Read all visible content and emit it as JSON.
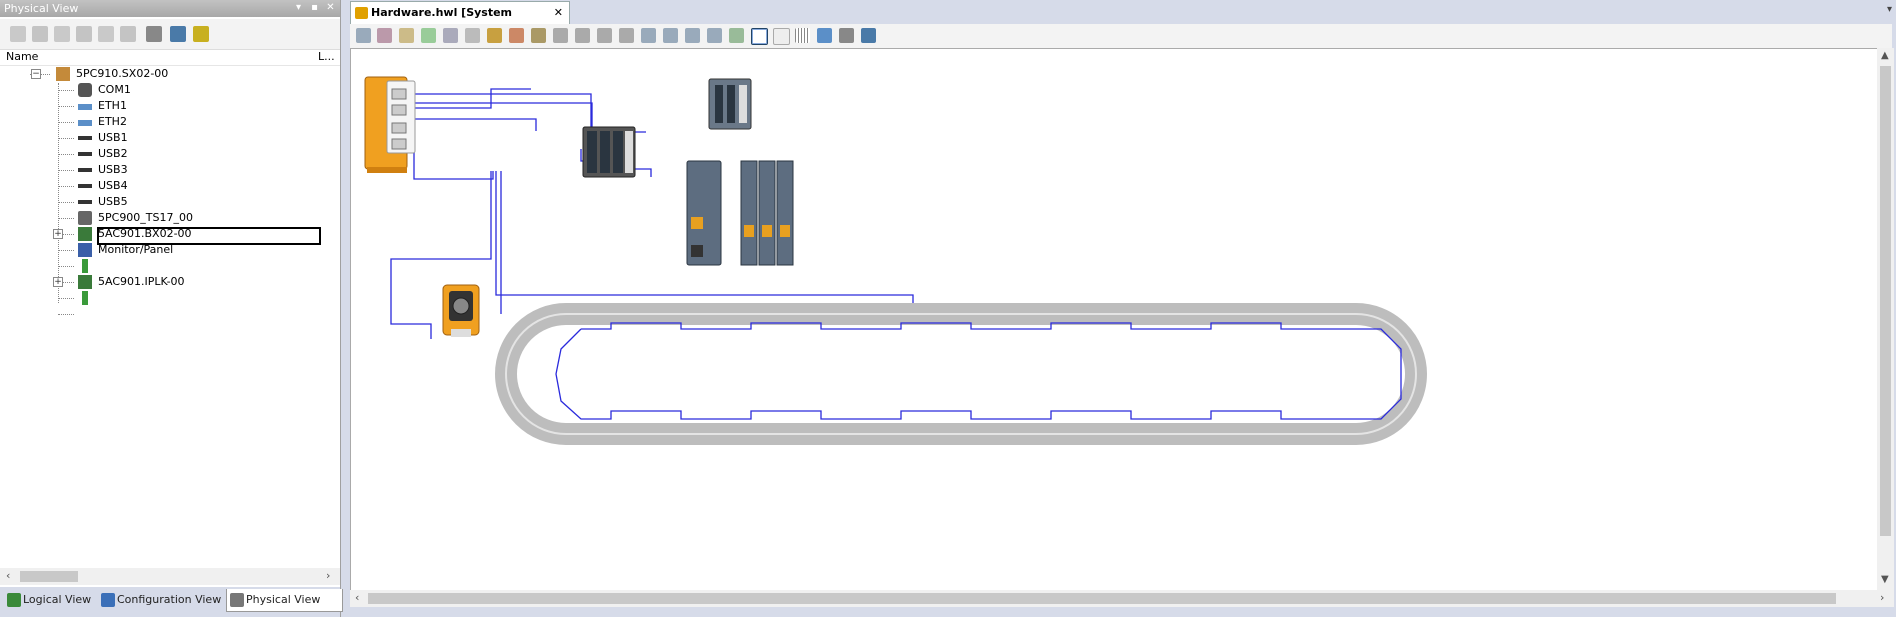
{
  "left_panel": {
    "title": "Physical View",
    "title_buttons": [
      "▾",
      "▪",
      "✕"
    ],
    "columns": {
      "name": "Name",
      "l": "L..."
    },
    "tree": [
      {
        "label": "5PC910.SX02-00",
        "icon": "pc-icon",
        "level": 0,
        "expanded": true
      },
      {
        "label": "COM1",
        "icon": "serial-port-icon",
        "level": 1
      },
      {
        "label": "ETH1",
        "icon": "ethernet-icon",
        "level": 1
      },
      {
        "label": "ETH2",
        "icon": "ethernet-icon",
        "level": 1
      },
      {
        "label": "USB1",
        "icon": "usb-icon",
        "level": 1
      },
      {
        "label": "USB2",
        "icon": "usb-icon",
        "level": 1
      },
      {
        "label": "USB3",
        "icon": "usb-icon",
        "level": 1
      },
      {
        "label": "USB4",
        "icon": "usb-icon",
        "level": 1
      },
      {
        "label": "USB5",
        "icon": "usb-icon",
        "level": 1
      },
      {
        "label": "5PC900_TS17_00",
        "icon": "module-icon",
        "level": 1
      },
      {
        "label": "5AC901.BX02-00",
        "icon": "card-icon",
        "level": 1,
        "selected": true,
        "collapsed": true
      },
      {
        "label": "Monitor/Panel",
        "icon": "monitor-icon",
        "level": 1
      },
      {
        "label": "",
        "icon": "plug-icon",
        "level": 1
      },
      {
        "label": "5AC901.IPLK-00",
        "icon": "card-icon",
        "level": 1,
        "collapsed": true
      },
      {
        "label": "",
        "icon": "plug-icon",
        "level": 1
      }
    ],
    "bottom_tabs": [
      {
        "label": "Logical View",
        "icon": "logical-view-icon",
        "active": false
      },
      {
        "label": "Configuration View",
        "icon": "configuration-view-icon",
        "active": false
      },
      {
        "label": "Physical View",
        "icon": "physical-view-icon",
        "active": true
      }
    ]
  },
  "editor": {
    "tab_title": "Hardware.hwl [System Designer]",
    "tab_close": "✕",
    "dropdown_arrow": "▾"
  },
  "colors": {
    "wire": "#2a2adc",
    "controller_orange": "#f0a020",
    "panel_bg": "#d6dbe9",
    "track_gray": "#c8c8c8"
  }
}
